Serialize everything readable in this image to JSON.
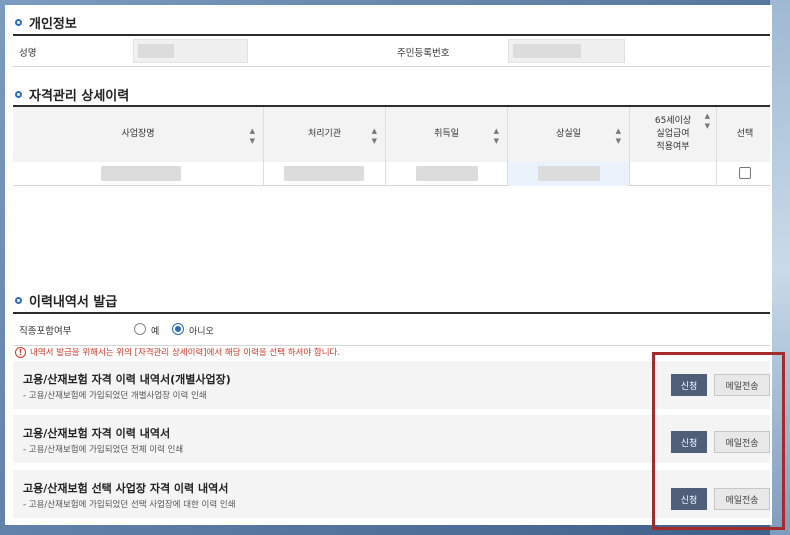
{
  "personal_info": {
    "title": "개인정보",
    "name_label": "성명",
    "rrn_label": "주민등록번호"
  },
  "history": {
    "title": "자격관리 상세이력",
    "columns": [
      "사업장명",
      "처리기관",
      "취득일",
      "상실일",
      "65세이상\n실업급여\n적용여부",
      "선택"
    ],
    "sort_icon": "sort-arrows-icon"
  },
  "issuance": {
    "title": "이력내역서 발급",
    "option_label": "직종포함여부",
    "option_yes": "예",
    "option_no": "아니오",
    "selected": "아니오",
    "notice": "내역서 발급을 위해서는 위의 [자격관리 상세이력]에서 해당 이력을 선택 하셔야 합니다.",
    "documents": [
      {
        "title": "고용/산재보험 자격 이력 내역서(개별사업장)",
        "desc": "- 고용/산재보험에 가입되었던 개별사업장 이력 인쇄",
        "apply": "신청",
        "mail": "메일전송"
      },
      {
        "title": "고용/산재보험 자격 이력 내역서",
        "desc": "- 고용/산재보험에 가입되었던 전체 이력 인쇄",
        "apply": "신청",
        "mail": "메일전송"
      },
      {
        "title": "고용/산재보험 선택 사업장 자격 이력 내역서",
        "desc": "- 고용/산재보험에 가입되었던 선택 사업장에 대한 이력 인쇄",
        "apply": "신청",
        "mail": "메일전송"
      }
    ]
  },
  "colors": {
    "accent_blue": "#2d6cb6",
    "apply_button": "#4f5f7a",
    "notice_red": "#d03a2a",
    "highlight_box": "#a52a2a"
  }
}
